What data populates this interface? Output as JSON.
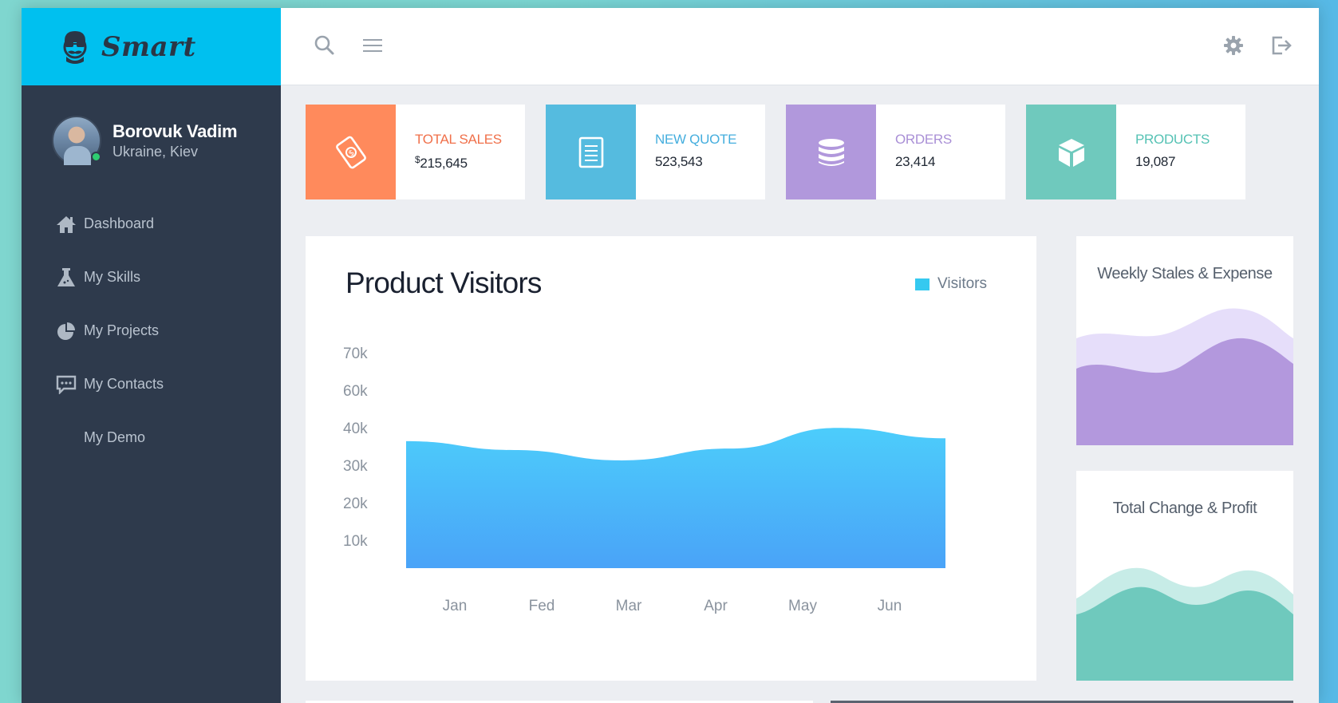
{
  "brand": {
    "name": "Smart",
    "logo_icon": "mustache-guy-icon"
  },
  "topbar": {
    "search_icon": "search-icon",
    "menu_icon": "hamburger-menu-icon",
    "settings_icon": "gear-icon",
    "logout_icon": "logout-icon"
  },
  "profile": {
    "name": "Borovuk Vadim",
    "location": "Ukraine, Kiev",
    "status": "online"
  },
  "nav": [
    {
      "label": "Dashboard",
      "icon": "home-icon"
    },
    {
      "label": "My Skills",
      "icon": "flask-icon"
    },
    {
      "label": "My Projects",
      "icon": "pie-chart-icon"
    },
    {
      "label": "My Contacts",
      "icon": "chat-bubble-icon"
    },
    {
      "label": "My Demo",
      "icon": ""
    }
  ],
  "stats": [
    {
      "label": "TOTAL SALES",
      "currency": "$",
      "value": "215,645",
      "icon": "money-bill-icon",
      "color": "#ff8a5c",
      "label_color": "#f0704a"
    },
    {
      "label": "NEW QUOTE",
      "currency": "",
      "value": "523,543",
      "icon": "document-icon",
      "color": "#55bbdf",
      "label_color": "#45aede"
    },
    {
      "label": "ORDERS",
      "currency": "",
      "value": "23,414",
      "icon": "database-icon",
      "color": "#b198dc",
      "label_color": "#a98fd6"
    },
    {
      "label": "PRODUCTS",
      "currency": "",
      "value": "19,087",
      "icon": "cube-icon",
      "color": "#6fc9bd",
      "label_color": "#55c2b4"
    }
  ],
  "visitors_panel": {
    "title": "Product Visitors",
    "legend_label": "Visitors"
  },
  "chart_data": {
    "type": "area",
    "title": "Product Visitors",
    "xlabel": "",
    "ylabel": "",
    "categories": [
      "Jan",
      "Fed",
      "Mar",
      "Apr",
      "May",
      "Jun"
    ],
    "y_ticks": [
      "10k",
      "20k",
      "30k",
      "40k",
      "60k",
      "70k"
    ],
    "series": [
      {
        "name": "Visitors",
        "values": [
          43000,
          40000,
          36500,
          40500,
          47500,
          44000
        ]
      }
    ],
    "ylim": [
      0,
      80000
    ],
    "grid": false,
    "legend_position": "top-right",
    "colors": {
      "top": "#4ccdfb",
      "bottom": "#4aa3f8"
    }
  },
  "weekly_panel": {
    "title": "Weekly Stales & Expense",
    "colors": {
      "back": "#e6defa",
      "front": "#b398dd"
    }
  },
  "profit_panel": {
    "title": "Total Change & Profit",
    "colors": {
      "back": "#c7ece7",
      "front": "#6fc9bd"
    }
  }
}
